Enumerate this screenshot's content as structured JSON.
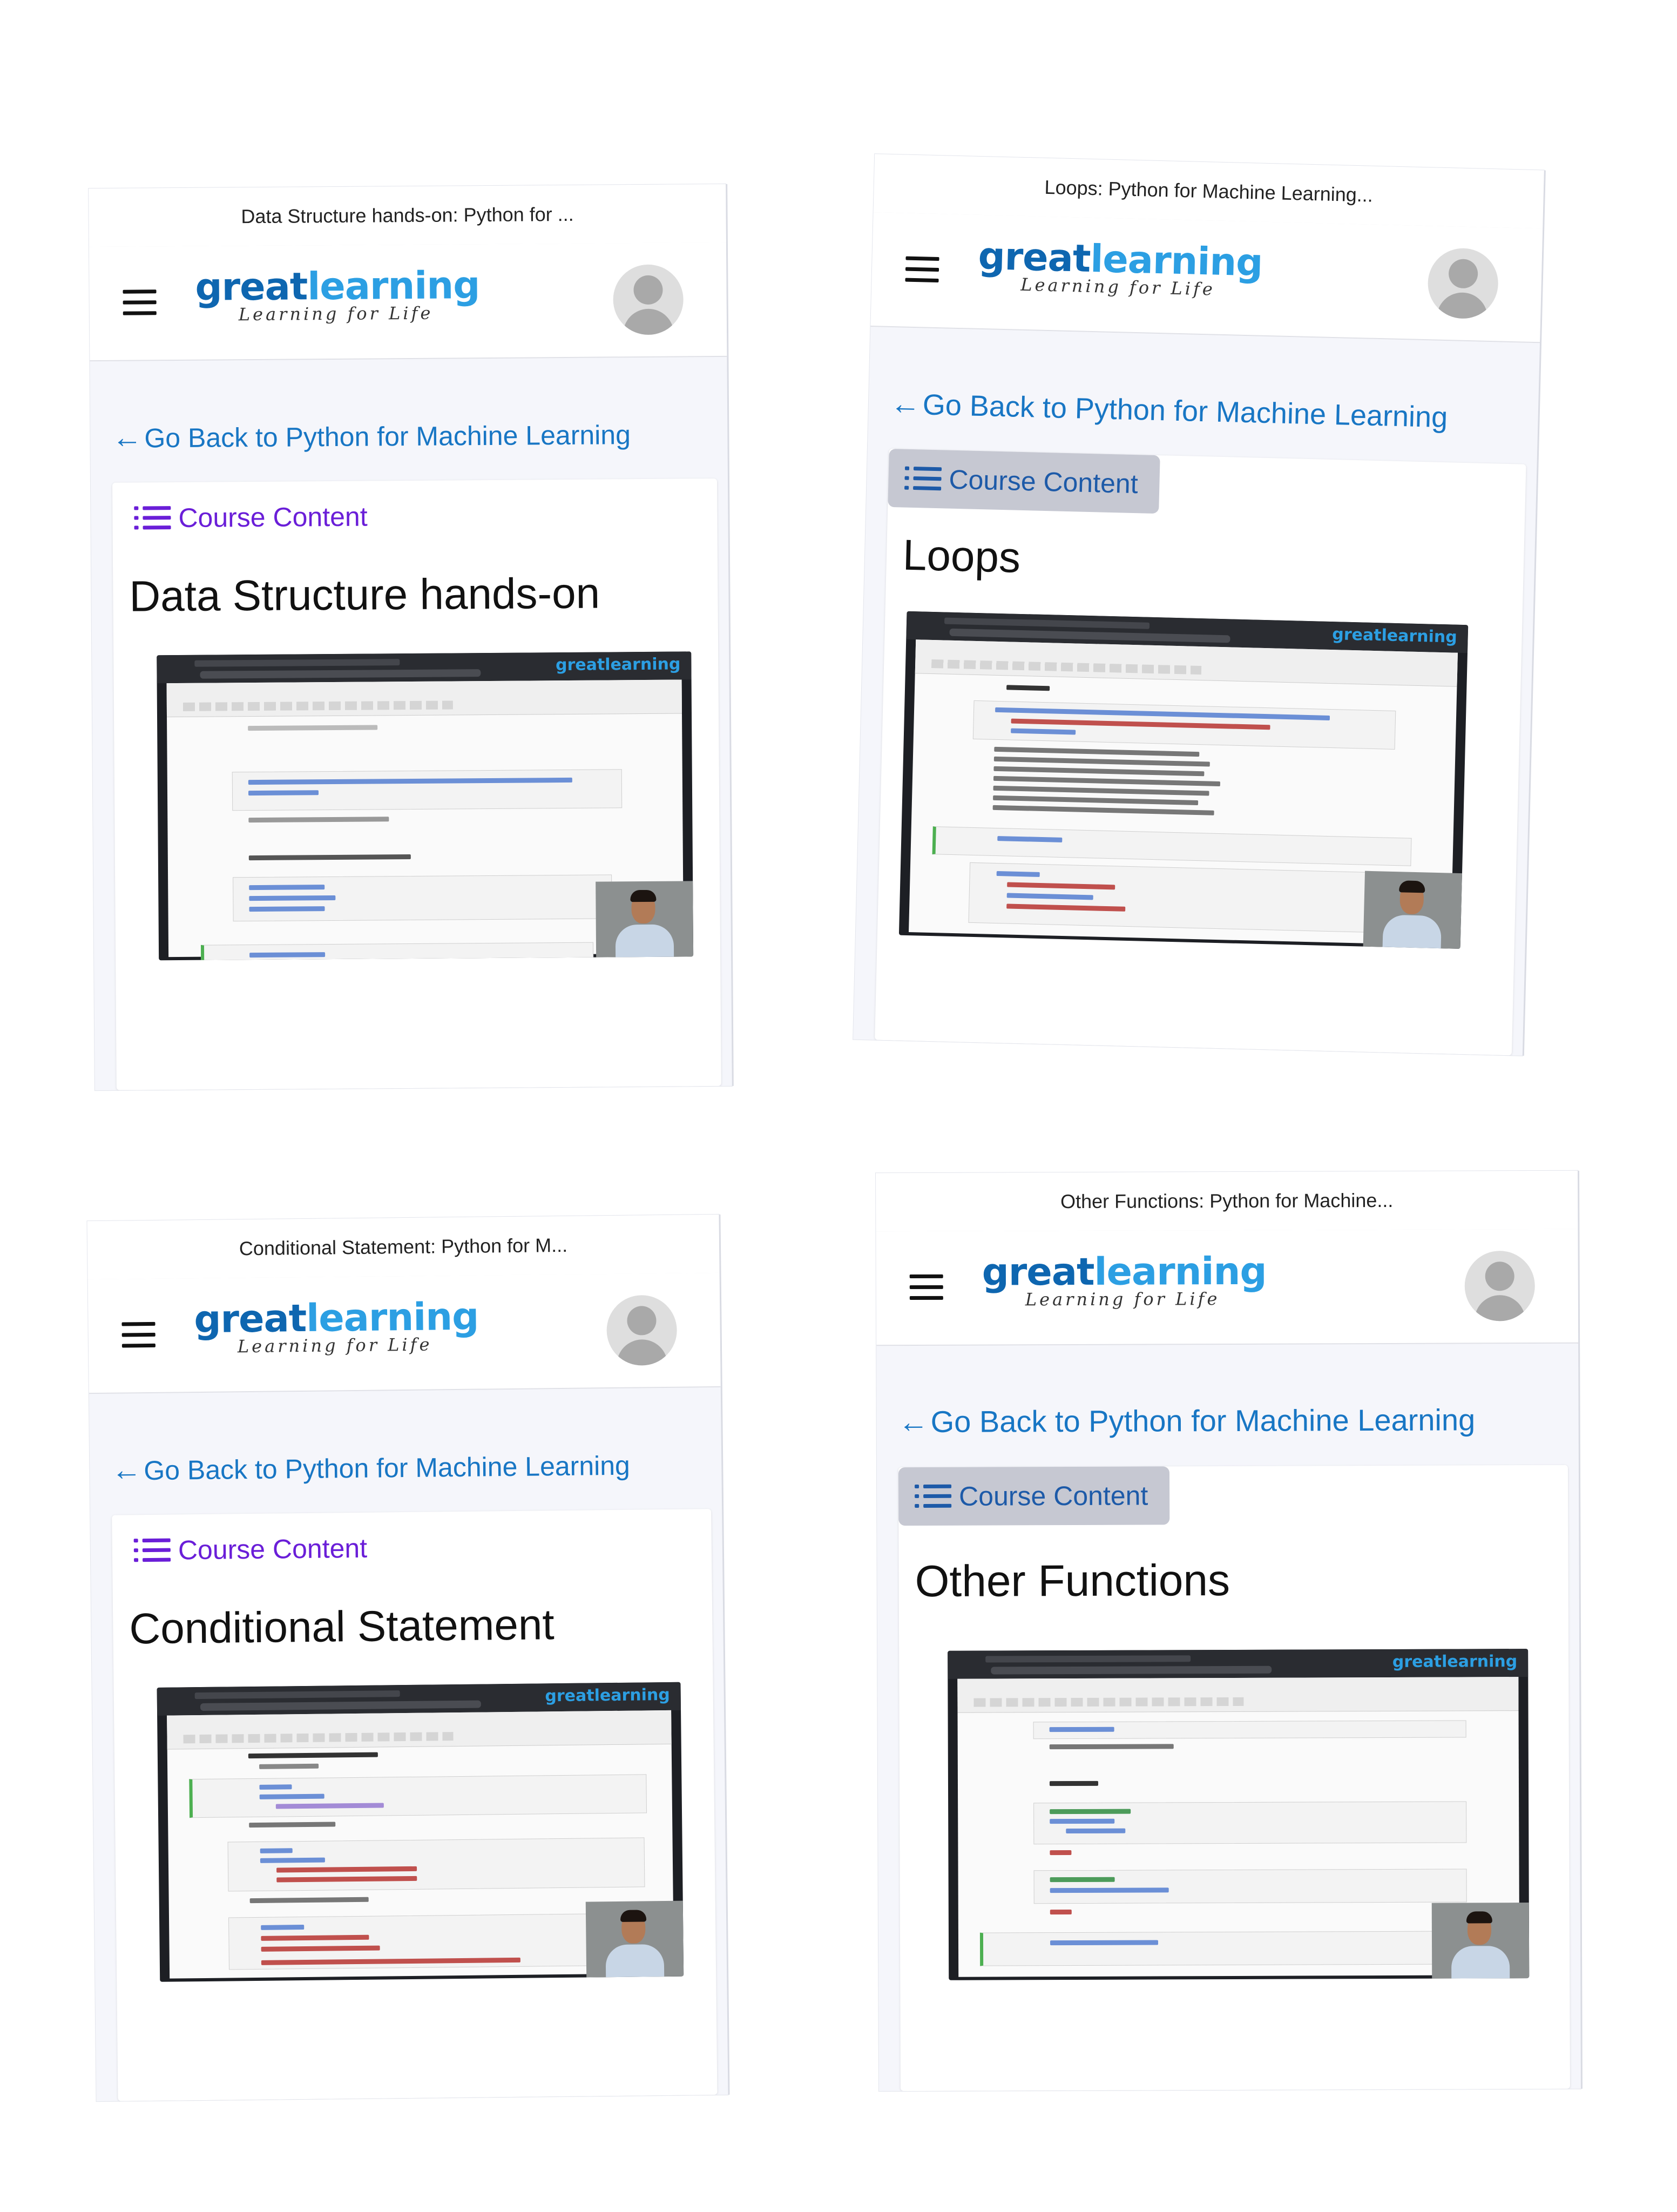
{
  "screenshots": [
    {
      "status_title": "Data Structure hands-on: Python for ...",
      "logo_part1": "great",
      "logo_part2": "learning",
      "logo_tagline": "Learning for Life",
      "back_arrow": "←",
      "back_link": "Go Back to Python for Machine Learning",
      "course_content": "Course Content",
      "lesson_title": "Data Structure hands-on",
      "video_logo": "greatlearning"
    },
    {
      "status_title": "Loops: Python for Machine Learning...",
      "logo_part1": "great",
      "logo_part2": "learning",
      "logo_tagline": "Learning for Life",
      "back_arrow": "←",
      "back_link": "Go Back to Python for Machine Learning",
      "course_content": "Course Content",
      "lesson_title": "Loops",
      "video_logo": "greatlearning"
    },
    {
      "status_title": "Conditional Statement: Python for M...",
      "logo_part1": "great",
      "logo_part2": "learning",
      "logo_tagline": "Learning for Life",
      "back_arrow": "←",
      "back_link": "Go Back to Python for Machine Learning",
      "course_content": "Course Content",
      "lesson_title": "Conditional Statement",
      "video_logo": "greatlearning"
    },
    {
      "status_title": "Other Functions: Python for Machine...",
      "logo_part1": "great",
      "logo_part2": "learning",
      "logo_tagline": "Learning for Life",
      "back_arrow": "←",
      "back_link": "Go Back to Python for Machine Learning",
      "course_content": "Course Content",
      "lesson_title": "Other Functions",
      "video_logo": "greatlearning"
    }
  ],
  "colors": {
    "logo_dark": "#0e66b0",
    "logo_light": "#2c9fe3",
    "link_blue": "#1876c4",
    "course_purple": "#6a1ed8",
    "pressed_bg": "#c6c8d2"
  },
  "icons": {
    "menu": "hamburger-menu-icon",
    "avatar": "user-avatar-icon",
    "back": "arrow-left-icon",
    "course": "list-icon"
  }
}
